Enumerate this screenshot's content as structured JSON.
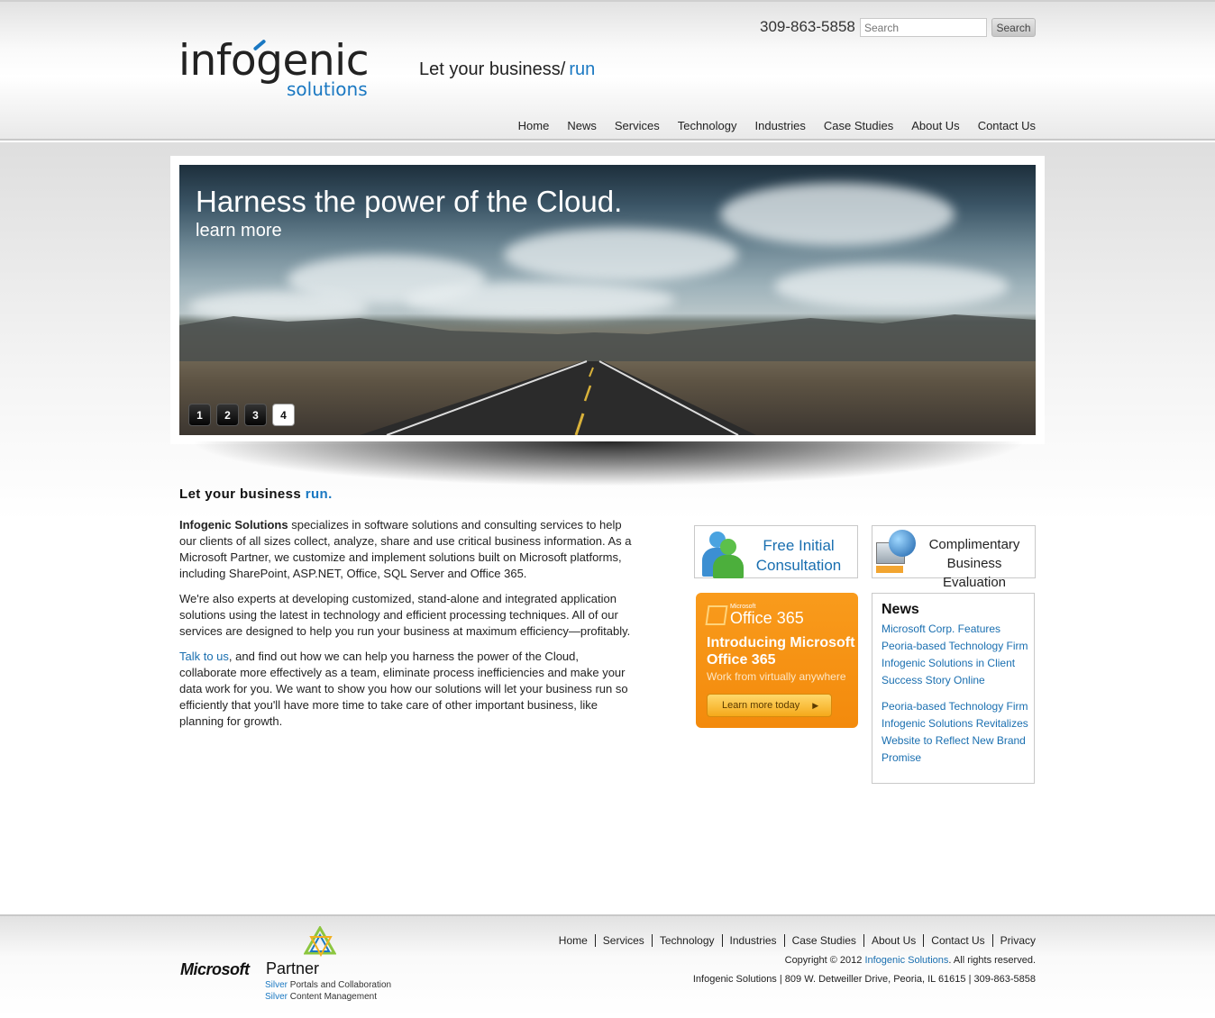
{
  "header": {
    "logo_main": "infogenic",
    "logo_sub": "solutions",
    "tagline_prefix": "Let your business/",
    "tagline_accent": "run",
    "phone": "309-863-5858",
    "search_placeholder": "Search",
    "search_button": "Search"
  },
  "nav": {
    "items": [
      "Home",
      "News",
      "Services",
      "Technology",
      "Industries",
      "Case Studies",
      "About Us",
      "Contact Us"
    ]
  },
  "slider": {
    "title": "Harness the power of the Cloud.",
    "link": "learn more",
    "pages": [
      "1",
      "2",
      "3",
      "4"
    ],
    "active_page": 4
  },
  "main": {
    "heading_prefix": "Let your business",
    "heading_accent": "run.",
    "p1_strong": "Infogenic Solutions",
    "p1_rest": " specializes in software solutions and consulting services to help our clients of all sizes collect, analyze, share and use critical business information. As a Microsoft Partner, we customize and implement solutions built on Microsoft platforms, including SharePoint, ASP.NET, Office, SQL Server and Office 365.",
    "p2": "We're also experts at developing customized, stand-alone and integrated application solutions using the latest in technology and efficient processing techniques. All of our services are designed to help you run your business at maximum efficiency—profitably.",
    "p3_link": "Talk to us",
    "p3_rest": ", and find out how we can help you harness the power of the Cloud, collaborate more effectively as a team, eliminate process inefficiencies and make your data work for you. We want to show you how our solutions will let your business run so efficiently that you'll have more time to take care of other important business, like planning for growth."
  },
  "cards": {
    "consultation": "Free Initial Consultation",
    "evaluation": "Complimentary Business Evaluation"
  },
  "office365": {
    "brand_ms": "Microsoft",
    "brand": "Office 365",
    "title": "Introducing Microsoft Office 365",
    "subtitle": "Work from virtually anywhere",
    "button": "Learn more today"
  },
  "news": {
    "title": "News",
    "items": [
      "Microsoft Corp. Features Peoria-based Technology Firm Infogenic Solutions in Client Success Story Online",
      "Peoria-based Technology Firm Infogenic Solutions Revitalizes Website to Reflect New Brand Promise"
    ]
  },
  "footer": {
    "nav": [
      "Home",
      "Services",
      "Technology",
      "Industries",
      "Case Studies",
      "About Us",
      "Contact Us",
      "Privacy"
    ],
    "copyright_prefix": "Copyright © 2012 ",
    "copyright_link": "Infogenic Solutions",
    "copyright_suffix": ". All rights reserved.",
    "address": "Infogenic Solutions | 809 W. Detweiller Drive, Peoria, IL 61615 | 309-863-5858",
    "ms_word": "Microsoft",
    "ms_partner": "Partner",
    "silver_word": "Silver",
    "silver1": " Portals and Collaboration",
    "silver2": " Content Management"
  },
  "colors": {
    "accent": "#1a78c2",
    "office_orange": "#f7941d"
  }
}
